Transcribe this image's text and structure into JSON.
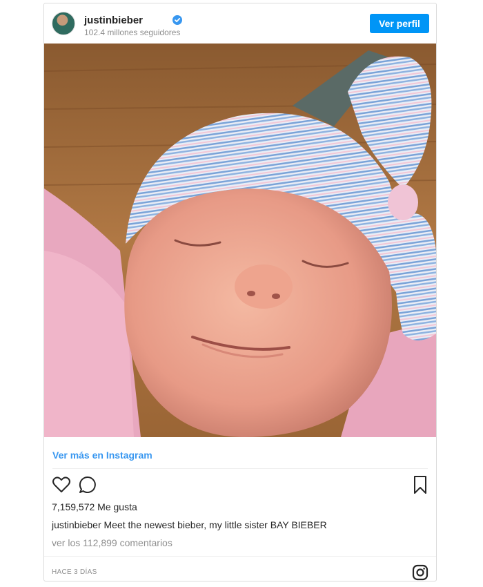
{
  "post": {
    "username": "justinbieber",
    "verified": true,
    "followers": "102.4 millones seguidores",
    "profile_button": "Ver perfil",
    "view_more_link": "Ver más en Instagram",
    "likes": "7,159,572 Me gusta",
    "caption_user": "justinbieber",
    "caption_text": "Meet the newest bieber, my little sister BAY BIEBER",
    "comments_link": "ver los 112,899 comentarios",
    "timestamp": "HACE 3 DÍAS"
  },
  "icons": {
    "like": "heart-icon",
    "comment": "comment-icon",
    "save": "bookmark-icon",
    "brand": "instagram-icon",
    "verified": "verified-badge-icon"
  },
  "colors": {
    "accent": "#0095f6",
    "link": "#3897f0",
    "text": "#262626",
    "muted": "#8e8e8e",
    "border": "#dbdbdb"
  }
}
